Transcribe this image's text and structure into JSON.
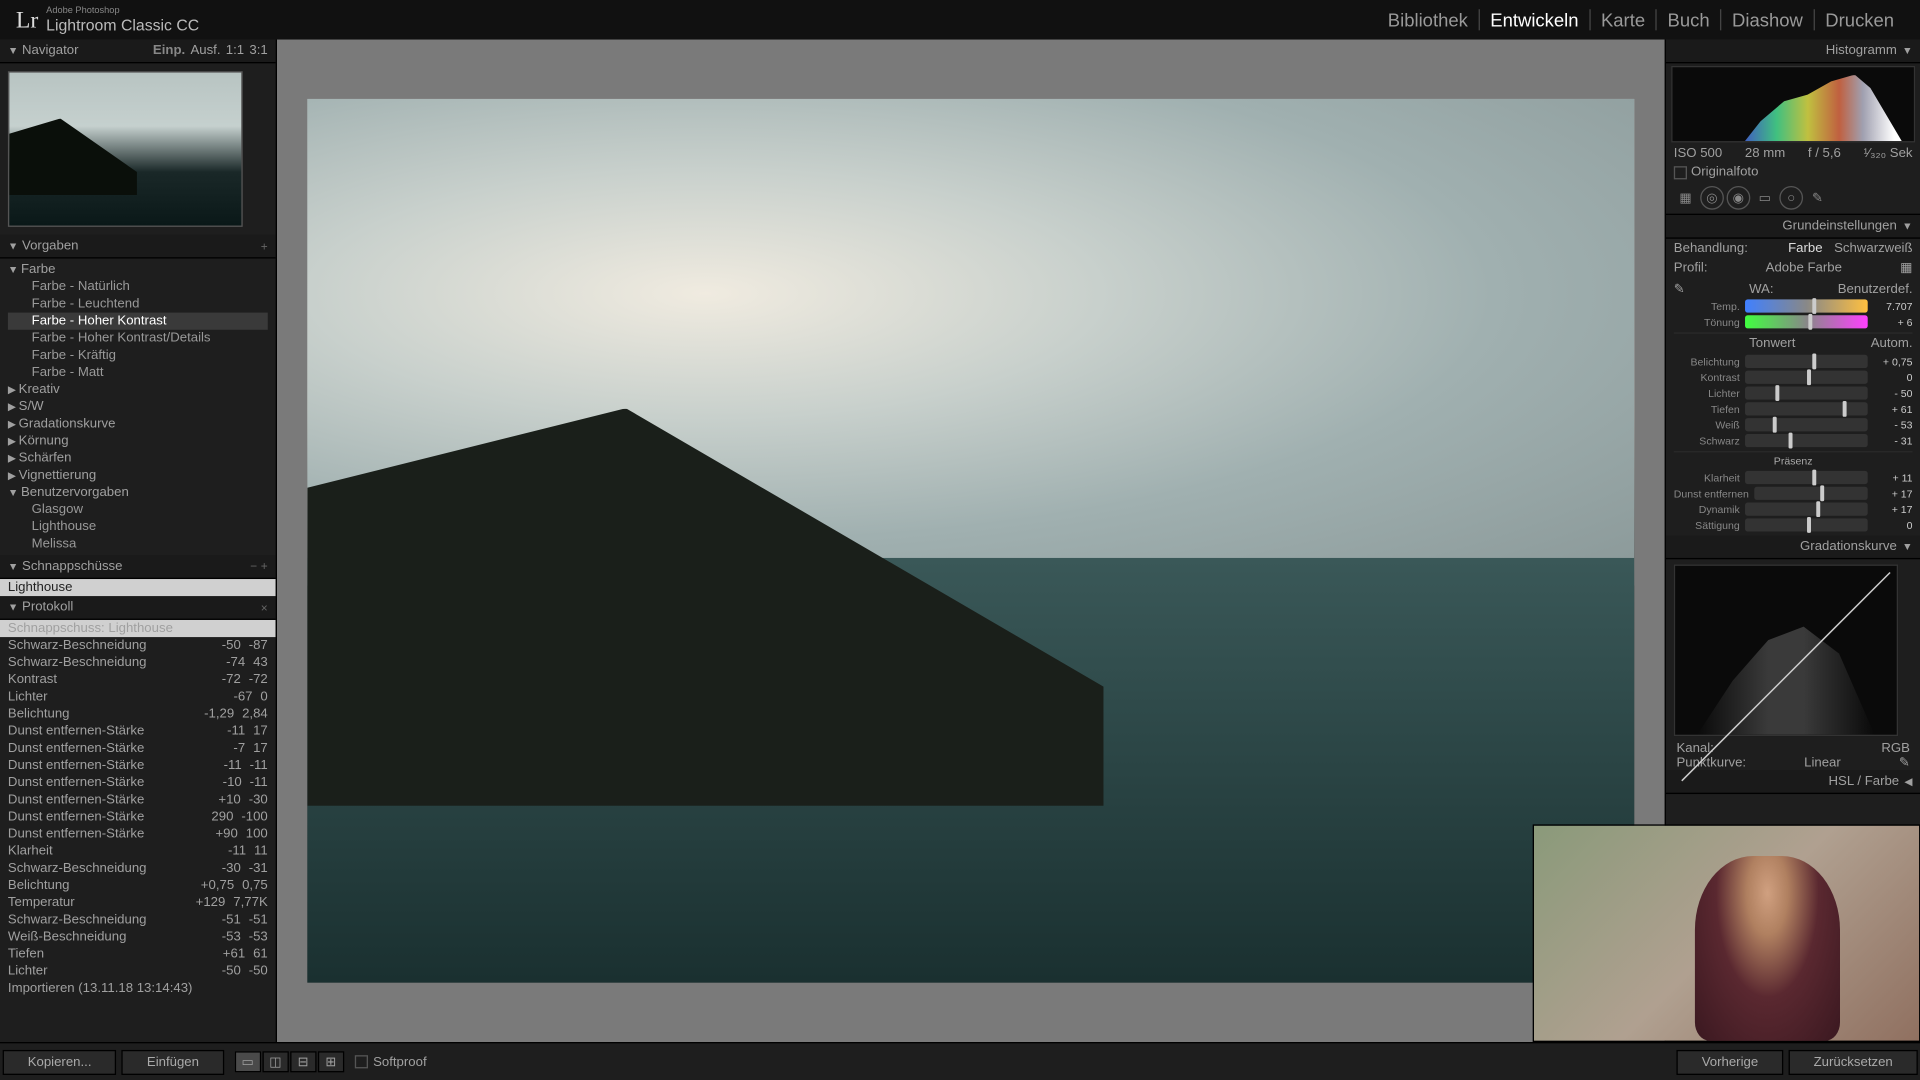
{
  "app": {
    "brand_small": "Adobe Photoshop",
    "brand": "Lightroom Classic CC"
  },
  "modules": [
    {
      "label": "Bibliothek",
      "active": false
    },
    {
      "label": "Entwickeln",
      "active": true
    },
    {
      "label": "Karte",
      "active": false
    },
    {
      "label": "Buch",
      "active": false
    },
    {
      "label": "Diashow",
      "active": false
    },
    {
      "label": "Drucken",
      "active": false
    }
  ],
  "navigator": {
    "title": "Navigator",
    "options": {
      "einp": "Einp.",
      "ausf": "Ausf.",
      "r1": "1:1",
      "r2": "3:1"
    }
  },
  "presets": {
    "title": "Vorgaben",
    "groups": [
      {
        "name": "Farbe",
        "open": true,
        "items": [
          "Farbe - Natürlich",
          "Farbe - Leuchtend",
          "Farbe - Hoher Kontrast",
          "Farbe - Hoher Kontrast/Details",
          "Farbe - Kräftig",
          "Farbe - Matt"
        ],
        "sel": 2
      },
      {
        "name": "Kreativ",
        "open": false
      },
      {
        "name": "S/W",
        "open": false
      },
      {
        "name": "Gradationskurve",
        "open": false
      },
      {
        "name": "Körnung",
        "open": false
      },
      {
        "name": "Schärfen",
        "open": false
      },
      {
        "name": "Vignettierung",
        "open": false
      },
      {
        "name": "Benutzervorgaben",
        "open": true,
        "items": [
          "Glasgow",
          "Lighthouse",
          "Melissa"
        ]
      }
    ]
  },
  "snapshots": {
    "title": "Schnappschüsse",
    "items": [
      "Lighthouse"
    ]
  },
  "history": {
    "title": "Protokoll",
    "items": [
      {
        "name": "Schnappschuss: Lighthouse",
        "v1": "",
        "v2": "",
        "sel": true
      },
      {
        "name": "Schwarz-Beschneidung",
        "v1": "-50",
        "v2": "-87"
      },
      {
        "name": "Schwarz-Beschneidung",
        "v1": "-74",
        "v2": "43"
      },
      {
        "name": "Kontrast",
        "v1": "-72",
        "v2": "-72"
      },
      {
        "name": "Lichter",
        "v1": "-67",
        "v2": "0"
      },
      {
        "name": "Belichtung",
        "v1": "-1,29",
        "v2": "2,84"
      },
      {
        "name": "Dunst entfernen-Stärke",
        "v1": "-11",
        "v2": "17"
      },
      {
        "name": "Dunst entfernen-Stärke",
        "v1": "-7",
        "v2": "17"
      },
      {
        "name": "Dunst entfernen-Stärke",
        "v1": "-11",
        "v2": "-11"
      },
      {
        "name": "Dunst entfernen-Stärke",
        "v1": "-10",
        "v2": "-11"
      },
      {
        "name": "Dunst entfernen-Stärke",
        "v1": "+10",
        "v2": "-30"
      },
      {
        "name": "Dunst entfernen-Stärke",
        "v1": "290",
        "v2": "-100"
      },
      {
        "name": "Dunst entfernen-Stärke",
        "v1": "+90",
        "v2": "100"
      },
      {
        "name": "Klarheit",
        "v1": "-11",
        "v2": "11"
      },
      {
        "name": "Schwarz-Beschneidung",
        "v1": "-30",
        "v2": "-31"
      },
      {
        "name": "Belichtung",
        "v1": "+0,75",
        "v2": "0,75"
      },
      {
        "name": "Temperatur",
        "v1": "+129",
        "v2": "7,77K"
      },
      {
        "name": "Schwarz-Beschneidung",
        "v1": "-51",
        "v2": "-51"
      },
      {
        "name": "Weiß-Beschneidung",
        "v1": "-53",
        "v2": "-53"
      },
      {
        "name": "Tiefen",
        "v1": "+61",
        "v2": "61"
      },
      {
        "name": "Lichter",
        "v1": "-50",
        "v2": "-50"
      },
      {
        "name": "Importieren (13.11.18 13:14:43)",
        "v1": "",
        "v2": ""
      }
    ]
  },
  "histogram": {
    "title": "Histogramm",
    "info": {
      "iso": "ISO 500",
      "focal": "28 mm",
      "aperture": "f / 5,6",
      "shutter": "¹⁄₃₂₀ Sek"
    },
    "original": "Originalfoto"
  },
  "basic": {
    "title": "Grundeinstellungen",
    "behandlung": {
      "label": "Behandlung:",
      "color": "Farbe",
      "bw": "Schwarzweiß"
    },
    "profil": {
      "label": "Profil:",
      "value": "Adobe Farbe"
    },
    "wb": {
      "label": "WA:",
      "value": "Benutzerdef."
    },
    "temp": {
      "label": "Temp.",
      "value": "7.707",
      "pos": 55
    },
    "tint": {
      "label": "Tönung",
      "value": "+ 6",
      "pos": 52
    },
    "tone": {
      "title": "Tonwert",
      "auto": "Autom."
    },
    "exposure": {
      "label": "Belichtung",
      "value": "+ 0,75",
      "pos": 55
    },
    "contrast": {
      "label": "Kontrast",
      "value": "0",
      "pos": 50
    },
    "highlights": {
      "label": "Lichter",
      "value": "- 50",
      "pos": 25
    },
    "shadows": {
      "label": "Tiefen",
      "value": "+ 61",
      "pos": 80
    },
    "whites": {
      "label": "Weiß",
      "value": "- 53",
      "pos": 23
    },
    "blacks": {
      "label": "Schwarz",
      "value": "- 31",
      "pos": 35
    },
    "presence": {
      "title": "Präsenz"
    },
    "clarity": {
      "label": "Klarheit",
      "value": "+ 11",
      "pos": 55
    },
    "dehaze": {
      "label": "Dunst entfernen",
      "value": "+ 17",
      "pos": 58
    },
    "vibrance": {
      "label": "Dynamik",
      "value": "+ 17",
      "pos": 58
    },
    "saturation": {
      "label": "Sättigung",
      "value": "0",
      "pos": 50
    }
  },
  "curve": {
    "title": "Gradationskurve",
    "kanal": {
      "label": "Kanal:",
      "value": "RGB"
    },
    "punkt": {
      "label": "Punktkurve:",
      "value": "Linear"
    }
  },
  "hsl": {
    "title": "HSL / Farbe"
  },
  "toolbar": {
    "copy": "Kopieren...",
    "paste": "Einfügen",
    "softproof": "Softproof",
    "prev": "Vorherige",
    "reset": "Zurücksetzen"
  }
}
